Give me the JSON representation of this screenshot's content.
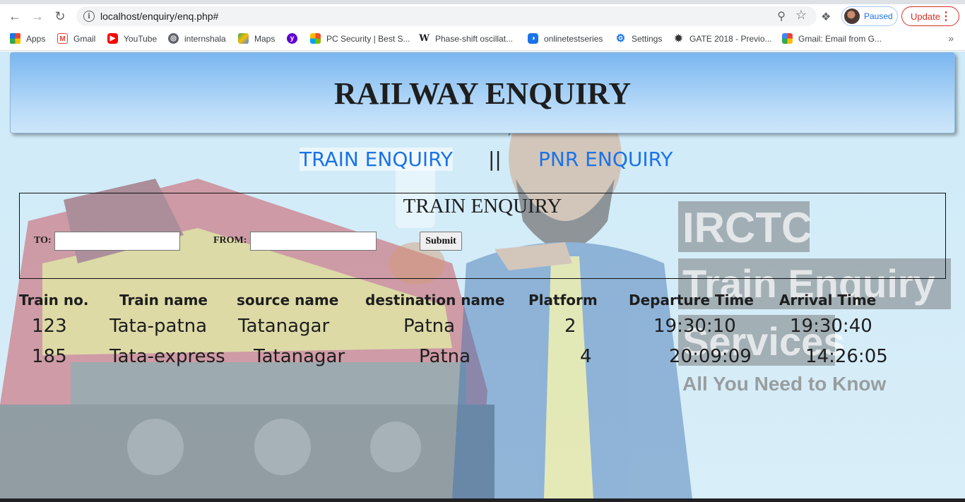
{
  "browser": {
    "url": "localhost/enquiry/enq.php#",
    "profile_status": "Paused",
    "update_label": "Update",
    "bookmarks": [
      {
        "label": "Apps",
        "icon": "apps-grid-icon",
        "color": "#1a73e8"
      },
      {
        "label": "Gmail",
        "icon": "gmail-icon",
        "color": "#ea4335"
      },
      {
        "label": "YouTube",
        "icon": "youtube-icon",
        "color": "#ff0000"
      },
      {
        "label": "internshala",
        "icon": "globe-icon",
        "color": "#5f6368"
      },
      {
        "label": "Maps",
        "icon": "maps-icon",
        "color": "#34a853"
      },
      {
        "label": "",
        "icon": "yahoo-icon",
        "color": "#6001d2"
      },
      {
        "label": "PC Security | Best S...",
        "icon": "windows-icon",
        "color": "#f25022"
      },
      {
        "label": "Phase-shift oscillat...",
        "icon": "wikipedia-icon",
        "color": "#202124"
      },
      {
        "label": "onlinetestseries",
        "icon": "onlinetestseries-icon",
        "color": "#1a73e8"
      },
      {
        "label": "Settings",
        "icon": "gear-icon",
        "color": "#1a73e8"
      },
      {
        "label": "GATE 2018 - Previo...",
        "icon": "gate-icon",
        "color": "#333333"
      },
      {
        "label": "Gmail: Email from G...",
        "icon": "google-icon",
        "color": "#fbbc05"
      }
    ]
  },
  "header": {
    "title": "RAILWAY ENQUIRY"
  },
  "nav": {
    "train_enquiry": "TRAIN ENQUIRY",
    "separator": "||",
    "pnr_enquiry": "PNR ENQUIRY"
  },
  "form": {
    "title": "TRAIN ENQUIRY",
    "to_label": "TO:",
    "to_value": "",
    "from_label": "FROM:",
    "from_value": "",
    "submit_label": "Submit"
  },
  "table": {
    "headers": [
      "Train no.",
      "Train name",
      "source name",
      "destination name",
      "Platform",
      "Departure Time",
      "Arrival Time"
    ],
    "rows": [
      [
        "123",
        "Tata-patna",
        "Tatanagar",
        "Patna",
        "2",
        "19:30:10",
        "19:30:40"
      ],
      [
        "185",
        "Tata-express",
        "Tatanagar",
        "Patna",
        "4",
        "20:09:09",
        "14:26:05"
      ]
    ]
  },
  "background_overlay": {
    "line1": "IRCTC",
    "line2": "Train Enquiry",
    "line3": "Services",
    "line4": "All You Need to Know"
  }
}
